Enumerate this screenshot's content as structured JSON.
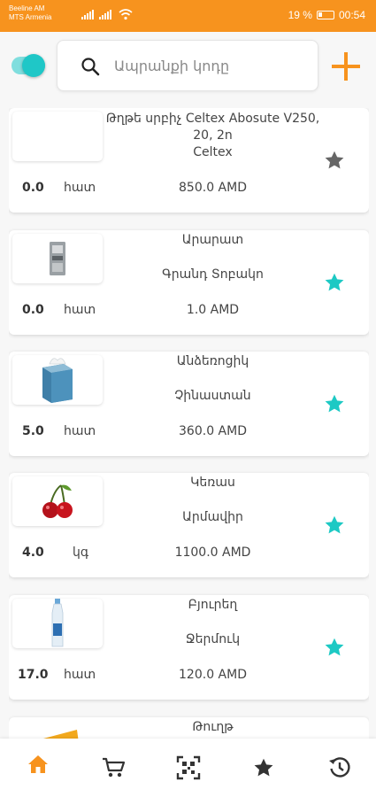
{
  "status_bar": {
    "carrier_1": "Beeline AM",
    "carrier_2": "MTS Armenia",
    "battery": "19 %",
    "time": "00:54"
  },
  "toolbar": {
    "toggle_on": true,
    "search_placeholder": "Ապրանքի կոդը",
    "add_icon": "plus-icon"
  },
  "colors": {
    "accent": "#f7931e",
    "teal": "#1fc7c7",
    "star_active": "#1dc9c4",
    "star_inactive": "#666666"
  },
  "products": [
    {
      "name": "Թղթե սրբիչ Celtex Abosute V250, 20, 2ո",
      "manufacturer": "Celtex",
      "qty": "0.0",
      "unit": "հատ",
      "price": "850.0 AMD",
      "favorite": false,
      "image": "blank"
    },
    {
      "name": "Արարատ",
      "manufacturer": "Գրանդ Տոբակո",
      "qty": "0.0",
      "unit": "հատ",
      "price": "1.0 AMD",
      "favorite": true,
      "image": "cigarette-pack"
    },
    {
      "name": "Անձեռոցիկ",
      "manufacturer": "Չինաստան",
      "qty": "5.0",
      "unit": "հատ",
      "price": "360.0 AMD",
      "favorite": true,
      "image": "tissue-box"
    },
    {
      "name": "Կեռաս",
      "manufacturer": "Արմավիր",
      "qty": "4.0",
      "unit": "կգ",
      "price": "1100.0 AMD",
      "favorite": true,
      "image": "cherries"
    },
    {
      "name": "Բյուրեղ",
      "manufacturer": "Ջերմուկ",
      "qty": "17.0",
      "unit": "հատ",
      "price": "120.0 AMD",
      "favorite": true,
      "image": "water-bottle"
    },
    {
      "name": "Թուղթ",
      "manufacturer": "",
      "qty": "",
      "unit": "",
      "price": "",
      "favorite": false,
      "image": "yellow-paper"
    }
  ],
  "bottom_nav": [
    {
      "icon": "home-icon",
      "active": true
    },
    {
      "icon": "cart-icon",
      "active": false
    },
    {
      "icon": "qr-code-icon",
      "active": false
    },
    {
      "icon": "star-icon",
      "active": false
    },
    {
      "icon": "history-icon",
      "active": false
    }
  ]
}
